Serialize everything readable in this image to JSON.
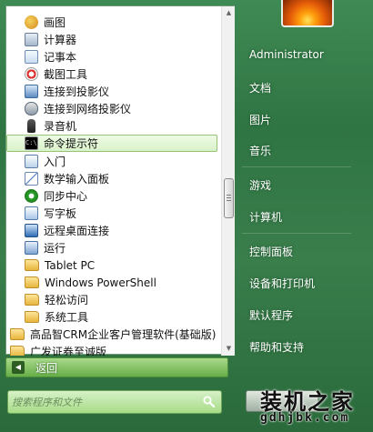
{
  "programs": [
    {
      "label": "画图",
      "icon": "paint-icon"
    },
    {
      "label": "计算器",
      "icon": "calculator-icon"
    },
    {
      "label": "记事本",
      "icon": "notepad-icon"
    },
    {
      "label": "截图工具",
      "icon": "snipping-tool-icon"
    },
    {
      "label": "连接到投影仪",
      "icon": "projector-icon"
    },
    {
      "label": "连接到网络投影仪",
      "icon": "network-projector-icon"
    },
    {
      "label": "录音机",
      "icon": "microphone-icon"
    },
    {
      "label": "命令提示符",
      "icon": "command-prompt-icon",
      "selected": true
    },
    {
      "label": "入门",
      "icon": "getting-started-icon"
    },
    {
      "label": "数学输入面板",
      "icon": "math-input-icon"
    },
    {
      "label": "同步中心",
      "icon": "sync-center-icon"
    },
    {
      "label": "写字板",
      "icon": "wordpad-icon"
    },
    {
      "label": "远程桌面连接",
      "icon": "remote-desktop-icon"
    },
    {
      "label": "运行",
      "icon": "run-icon"
    },
    {
      "label": "Tablet PC",
      "icon": "folder-icon"
    },
    {
      "label": "Windows PowerShell",
      "icon": "folder-icon"
    },
    {
      "label": "轻松访问",
      "icon": "folder-icon"
    },
    {
      "label": "系统工具",
      "icon": "folder-icon"
    },
    {
      "label": "高品智CRM企业客户管理软件(基础版)",
      "icon": "folder-icon"
    },
    {
      "label": "广发证券至诚版",
      "icon": "folder-icon"
    }
  ],
  "cmd_icon_text": "C:\\_",
  "back_label": "返回",
  "search": {
    "placeholder": "搜索程序和文件"
  },
  "right_items": [
    "Administrator",
    "文档",
    "图片",
    "音乐",
    "游戏",
    "计算机",
    "控制面板",
    "设备和打印机",
    "默认程序",
    "帮助和支持"
  ],
  "watermark": {
    "cn": "装机之家",
    "url": "gdhjbk.com"
  },
  "colors": {
    "accent": "#67ad48",
    "highlight": "#d9f2c9"
  }
}
